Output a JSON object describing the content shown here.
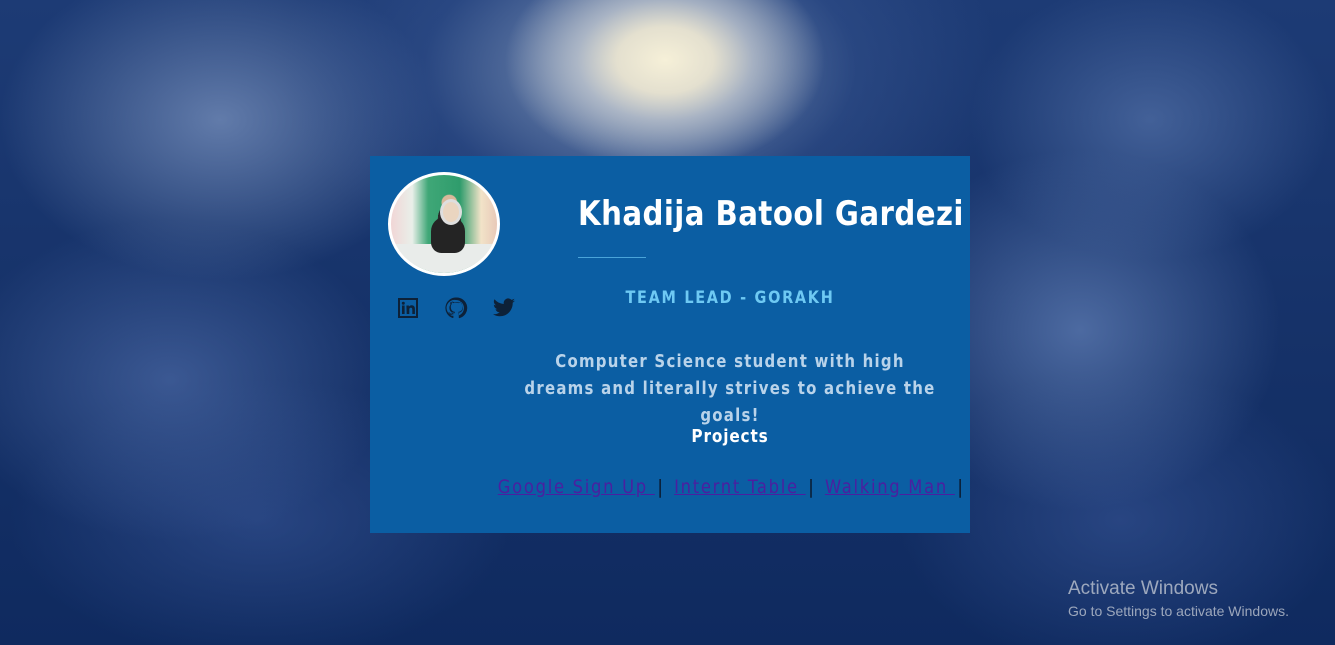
{
  "profile": {
    "name": "Khadija Batool Gardezi",
    "role": "TEAM LEAD - GORAKH",
    "bio": "Computer Science student with high dreams and literally strives to achieve the goals!",
    "avatar_icon": "profile-photo"
  },
  "social": [
    {
      "name": "linkedin",
      "icon": "linkedin-icon"
    },
    {
      "name": "github",
      "icon": "github-icon"
    },
    {
      "name": "twitter",
      "icon": "twitter-icon"
    }
  ],
  "projects": {
    "heading": "Projects",
    "links": [
      "Google Sign Up ",
      "Internt Table ",
      "Walking Man "
    ],
    "separator": "|"
  },
  "watermark": {
    "title": "Activate Windows",
    "subtitle": "Go to Settings to activate Windows."
  },
  "colors": {
    "card_bg": "#0b5ea3",
    "role": "#6ec9f3",
    "bio": "#b9d3ea",
    "link": "#4b1fa0",
    "title": "#ffffff"
  }
}
